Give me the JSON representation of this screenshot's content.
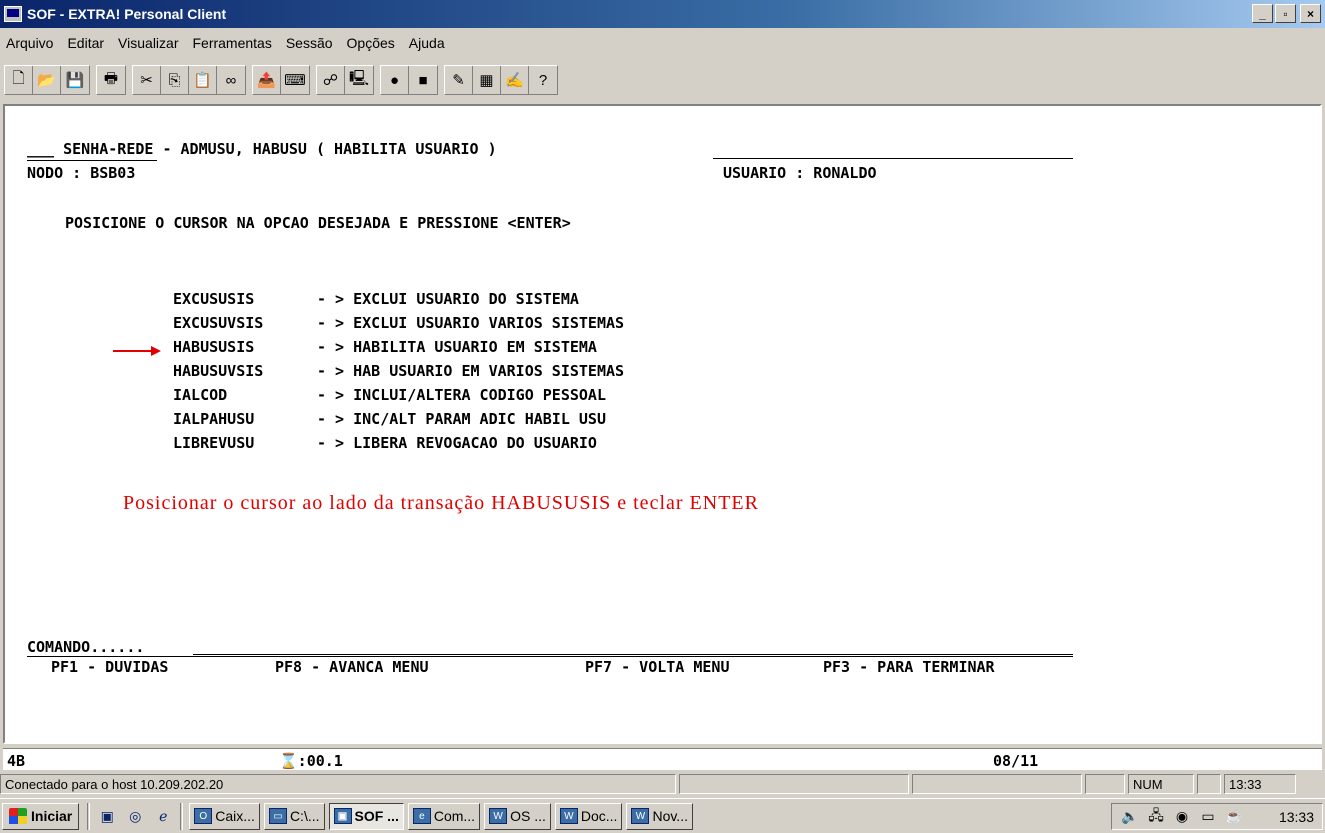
{
  "window": {
    "title": "SOF - EXTRA! Personal Client",
    "minimize": "_",
    "maximize": "▫",
    "close": "×"
  },
  "menu": [
    "Arquivo",
    "Editar",
    "Visualizar",
    "Ferramentas",
    "Sessão",
    "Opções",
    "Ajuda"
  ],
  "toolbar": {
    "icons": [
      "new-document-icon",
      "open-folder-icon",
      "save-icon",
      "print-icon",
      "cut-icon",
      "copy-icon",
      "paste-icon",
      "macro-icon",
      "send-file-icon",
      "keyboard-map-icon",
      "hotspot-icon",
      "session-icon",
      "record-icon",
      "record-stop-icon",
      "edit-macro-icon",
      "toolbar-edit-icon",
      "quickpad-icon",
      "help-icon"
    ],
    "glyphs": [
      "🗋",
      "📂",
      "💾",
      "🖶",
      "✂",
      "⎘",
      "📋",
      "∞",
      "📤",
      "⌨",
      "☍",
      "🖳",
      "●",
      "■",
      "✎",
      "▦",
      "✍",
      "?"
    ]
  },
  "terminal": {
    "header_line": "___ SENHA-REDE - ADMUSU, HABUSU ( HABILITA USUARIO )",
    "node": "NODO : BSB03",
    "user": "USUARIO : RONALDO",
    "instruction": "POSICIONE O CURSOR NA OPCAO DESEJADA E PRESSIONE <ENTER>",
    "options": [
      {
        "code": "EXCUSUSIS ",
        "desc": "- > EXCLUI USUARIO DO SISTEMA"
      },
      {
        "code": "EXCUSUVSIS",
        "desc": "- > EXCLUI USUARIO VARIOS SISTEMAS"
      },
      {
        "code": "HABUSUSIS ",
        "desc": "- > HABILITA USUARIO EM SISTEMA"
      },
      {
        "code": "HABUSUVSIS",
        "desc": "- > HAB USUARIO EM VARIOS SISTEMAS"
      },
      {
        "code": "IALCOD    ",
        "desc": "- > INCLUI/ALTERA CODIGO PESSOAL"
      },
      {
        "code": "IALPAHUSU ",
        "desc": "- > INC/ALT PARAM ADIC HABIL USU"
      },
      {
        "code": "LIBREVUSU ",
        "desc": "- > LIBERA REVOGACAO DO USUARIO"
      }
    ],
    "annotation": "Posicionar o cursor ao lado da transação HABUSUSIS e teclar ENTER",
    "command_label": "COMANDO......",
    "pf_keys": [
      "PF1 - DUVIDAS",
      "PF8 - AVANCA MENU",
      "PF7 - VOLTA MENU",
      "PF3 - PARA TERMINAR"
    ]
  },
  "oia": {
    "indicator": "4B",
    "timer": "⌛:00.1",
    "cursor_pos": "08/11"
  },
  "status": {
    "connection": "Conectado para o host 10.209.202.20",
    "num": "NUM",
    "time": "13:33"
  },
  "taskbar": {
    "start": "Iniciar",
    "tasks": [
      {
        "label": "Caix...",
        "icon": "O"
      },
      {
        "label": "C:\\...",
        "icon": "▭"
      },
      {
        "label": "SOF ...",
        "icon": "▣"
      },
      {
        "label": "Com...",
        "icon": "e"
      },
      {
        "label": "OS ...",
        "icon": "W"
      },
      {
        "label": "Doc...",
        "icon": "W"
      },
      {
        "label": "Nov...",
        "icon": "W"
      }
    ],
    "clock": "13:33"
  }
}
